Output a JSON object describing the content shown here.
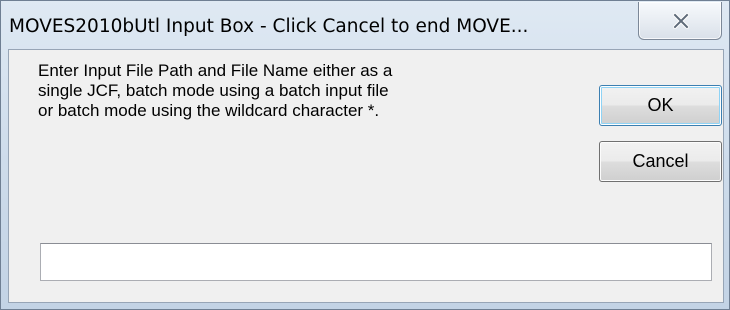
{
  "window": {
    "title": "MOVES2010bUtl Input Box - Click Cancel to end MOVE..."
  },
  "dialog": {
    "prompt_lines": [
      "Enter Input File Path and File Name either as a",
      "single JCF, batch mode using a batch input file",
      "or batch mode using the wildcard character *."
    ],
    "ok_label": "OK",
    "cancel_label": "Cancel",
    "input_value": ""
  },
  "icons": {
    "close": "close-icon"
  },
  "colors": {
    "frame": "#d3e0ee",
    "client": "#f0f0f0",
    "default_button_border": "#3c7fb1"
  }
}
